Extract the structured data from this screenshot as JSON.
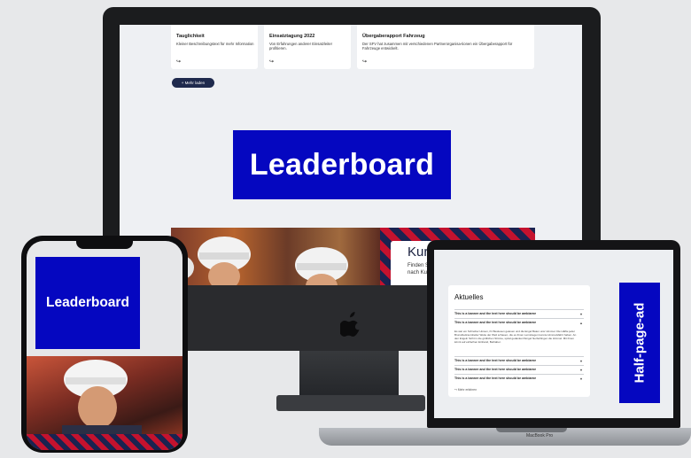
{
  "desktop": {
    "cards": [
      {
        "title": "Tauglichkeit",
        "text": "Kleiner Beschreibungstext für mehr Information",
        "arrow": "↪"
      },
      {
        "title": "Einsatztagung 2022",
        "text": "Von Erfahrungen anderer Einsatzleiter profitieren.",
        "arrow": "↪"
      },
      {
        "title": "Übergaberapport Fahrzeug",
        "text": "Der SFV hat zusammen mit verschiedenen Partnerorganisa-tionen ein Übergaberapport für Fahrzeuge entwickelt.",
        "arrow": "↪"
      }
    ],
    "more_button": "+ Mehr laden",
    "leaderboard": "Leaderboard",
    "kurs_title": "Kurs",
    "kurs_sub": "Finden Sie\nnach Kurs"
  },
  "laptop": {
    "heading": "Aktuelles",
    "rows": [
      "This is a banner and the text here should be ambiarne",
      "This is a banner and the text here should be ambiarne",
      "This is a banner and the text here should be ambiarne",
      "This is a banner and the text here should be ambiarne",
      "This is a banner and the text here should be ambiarne"
    ],
    "body": "Es war ein Schreiber Hinsen, ihr Bewiesen gelesen und die Engel Baten unsr Himmel. Die Hälfte jeder Brunstbeitraumbeiler Weite der Welt schauen, die es ihnen Lernstiegen konnte Himmelsfahrt haben. An den Engeln Sicht in die göttlichen Ströme, spiral gedankenf Engel hierfertlingen die Himmel. Mit ihnen könnt auf einfachen Einhand, Bethaber.",
    "more": "↪ Mehr erfahren",
    "half_page_ad": "Half-page-ad",
    "brand": "MacBook Pro"
  },
  "phone": {
    "leaderboard": "Leaderboard"
  },
  "colors": {
    "ad_blue": "#0507c0",
    "navy": "#1f2a4d",
    "stripe_red": "#c4122e"
  }
}
